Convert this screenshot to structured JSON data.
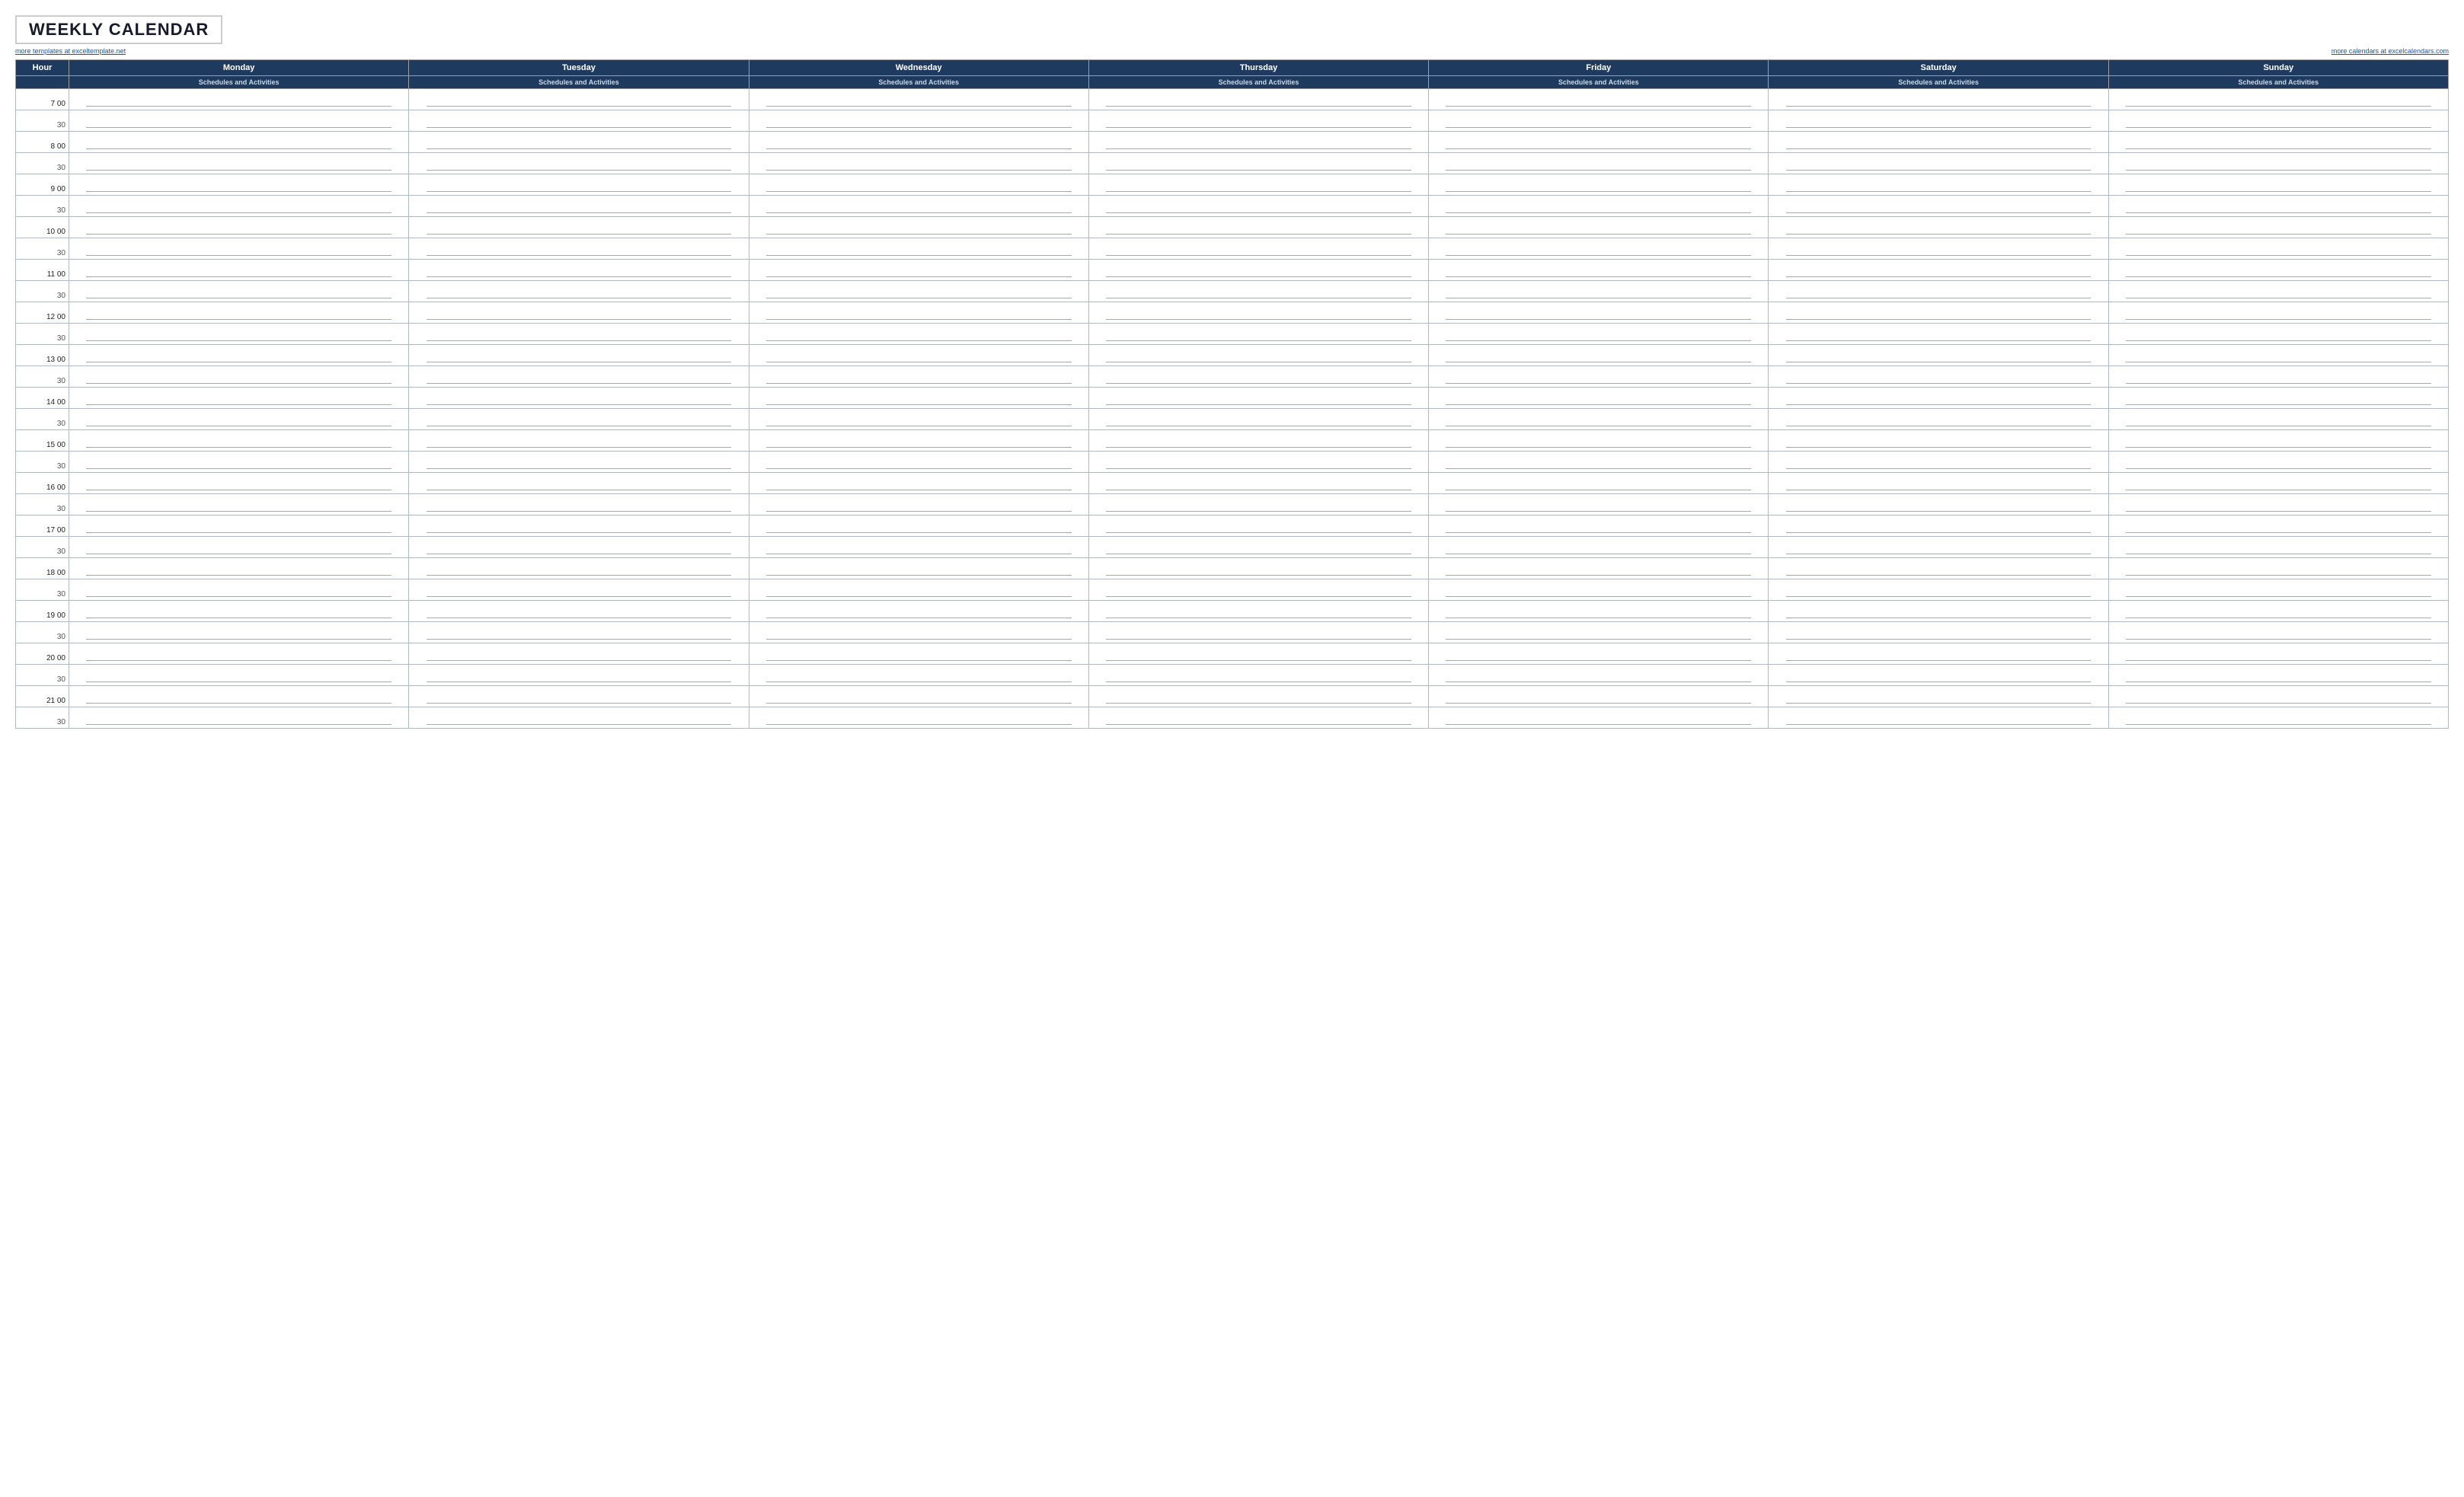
{
  "title": "WEEKLY CALENDAR",
  "link_left": "more templates at exceltemplate.net",
  "link_right": "more calendars at excelcalendars.com",
  "header": {
    "hour_label": "Hour",
    "days": [
      "Monday",
      "Tuesday",
      "Wednesday",
      "Thursday",
      "Friday",
      "Saturday",
      "Sunday"
    ],
    "subheader": "Schedules and Activities"
  },
  "hours": [
    {
      "label": "7  00",
      "half": "30"
    },
    {
      "label": "8  00",
      "half": "30"
    },
    {
      "label": "9  00",
      "half": "30"
    },
    {
      "label": "10  00",
      "half": "30"
    },
    {
      "label": "11  00",
      "half": "30"
    },
    {
      "label": "12  00",
      "half": "30"
    },
    {
      "label": "13  00",
      "half": "30"
    },
    {
      "label": "14  00",
      "half": "30"
    },
    {
      "label": "15  00",
      "half": "30"
    },
    {
      "label": "16  00",
      "half": "30"
    },
    {
      "label": "17  00",
      "half": "30"
    },
    {
      "label": "18  00",
      "half": "30"
    },
    {
      "label": "19  00",
      "half": "30"
    },
    {
      "label": "20  00",
      "half": "30"
    },
    {
      "label": "21  00",
      "half": "30"
    }
  ]
}
